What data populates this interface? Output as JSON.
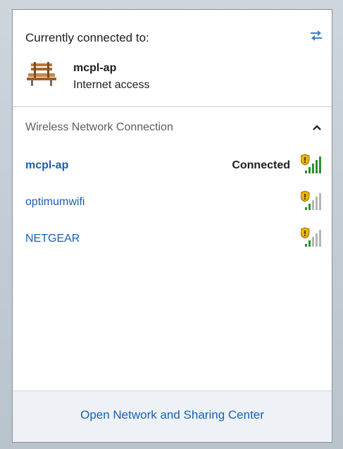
{
  "connection": {
    "title": "Currently connected to:",
    "network_name": "mcpl-ap",
    "status": "Internet access",
    "icon": "bench-icon",
    "refresh_icon": "refresh-icon"
  },
  "wireless": {
    "title": "Wireless Network Connection",
    "chevron_icon": "chevron-up-icon",
    "networks": [
      {
        "name": "mcpl-ap",
        "state": "Connected",
        "signal_bars": 5,
        "secured": true
      },
      {
        "name": "optimumwifi",
        "state": "",
        "signal_bars": 2,
        "secured": true
      },
      {
        "name": "NETGEAR",
        "state": "",
        "signal_bars": 2,
        "secured": true
      }
    ]
  },
  "footer": {
    "link_label": "Open Network and Sharing Center"
  },
  "colors": {
    "link_blue": "#1a5fb4",
    "signal_green": "#2f8f2f",
    "signal_gray": "#b5b5b5",
    "shield_yellow": "#e8b400"
  }
}
